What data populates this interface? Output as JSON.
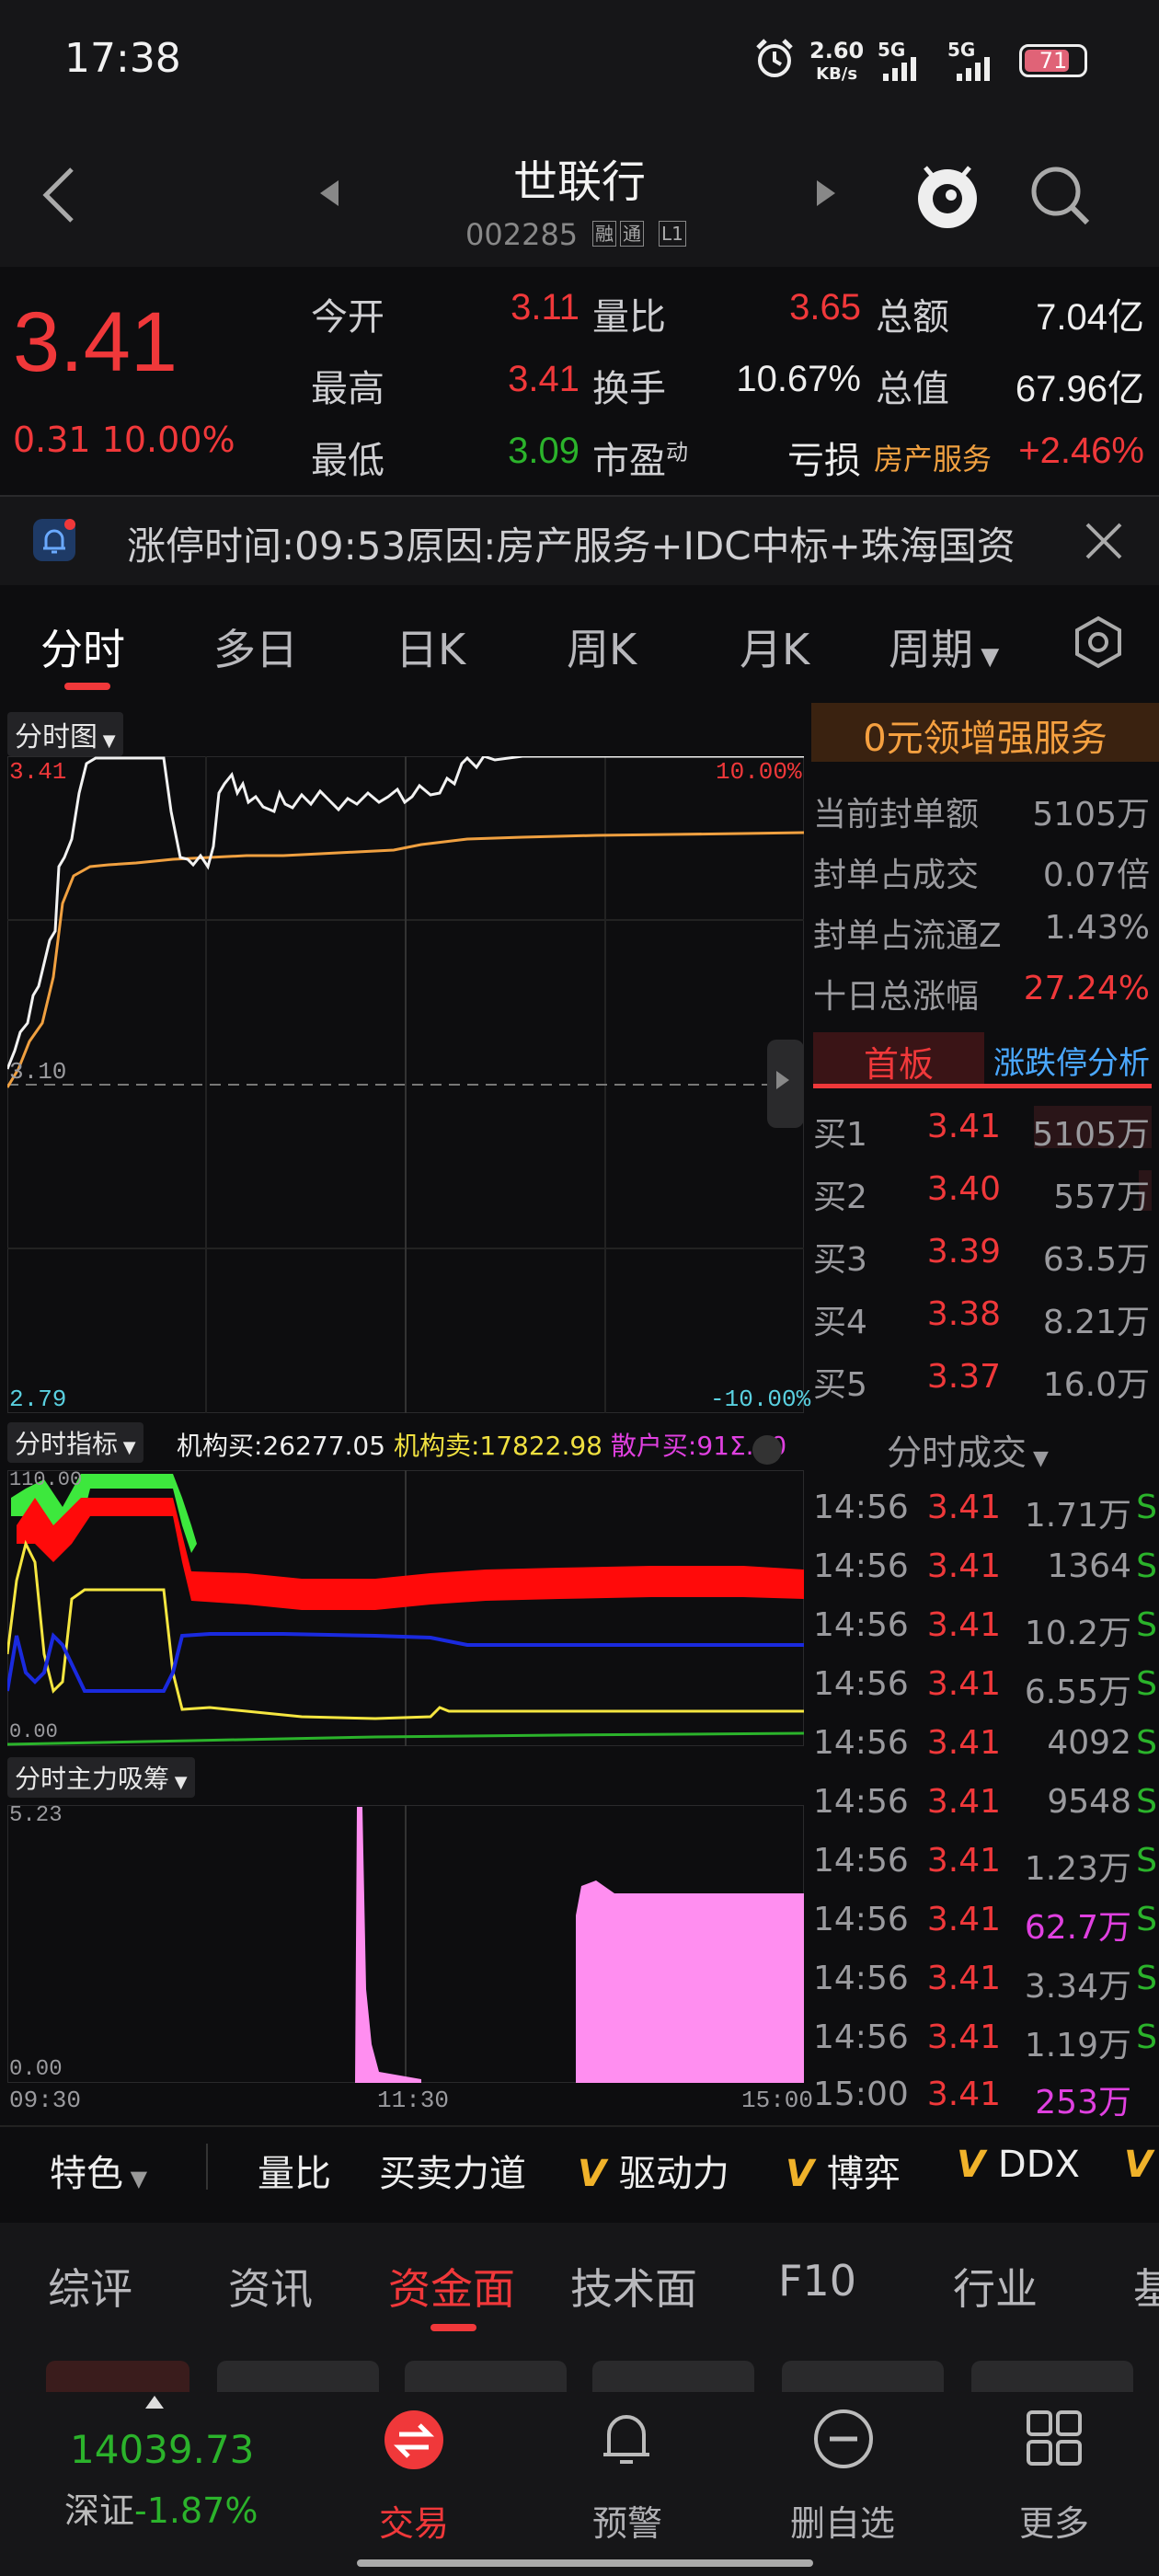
{
  "status_bar": {
    "time": "17:38",
    "net_speed_value": "2.60",
    "net_speed_unit": "KB/s",
    "sim1": "5G",
    "sim2": "5G",
    "battery": "71"
  },
  "header": {
    "name": "世联行",
    "code": "002285",
    "tags": [
      "融",
      "通",
      "L1"
    ]
  },
  "quote": {
    "price": "3.41",
    "change": "0.31",
    "change_pct": "10.00%",
    "rows": [
      {
        "l1": "今开",
        "v1": "3.11",
        "l2": "量比",
        "v2": "3.65",
        "l3": "总额",
        "v3": "7.04亿"
      },
      {
        "l1": "最高",
        "v1": "3.41",
        "l2": "换手",
        "v2": "10.67%",
        "l3": "总值",
        "v3": "67.96亿"
      },
      {
        "l1": "最低",
        "v1": "3.09",
        "l2": "市盈",
        "l2_sup": "动",
        "v2": "亏损",
        "l3": "房产服务",
        "v3": "+2.46%"
      }
    ]
  },
  "notice": {
    "text": "涨停时间:09:53原因:房产服务+IDC中标+珠海国资"
  },
  "period_tabs": [
    "分时",
    "多日",
    "日K",
    "周K",
    "月K",
    "周期"
  ],
  "minute_chart": {
    "dropdown": "分时图",
    "price_high": "3.41",
    "price_mid": "3.10",
    "price_low": "2.79",
    "pct_high": "10.00%",
    "pct_low": "-10.00%"
  },
  "indicator": {
    "dropdown": "分时指标",
    "inst_buy_label": "机构买:",
    "inst_buy": "26277.05",
    "inst_sell_label": "机构卖:",
    "inst_sell": "17822.98",
    "retail_buy_label": "散户买:",
    "retail_buy": "91Σ.40",
    "top": "110.00",
    "bottom": "0.00"
  },
  "absorb": {
    "dropdown": "分时主力吸筹",
    "top": "5.23",
    "bottom": "0.00",
    "t_start": "09:30",
    "t_mid": "11:30",
    "t_end": "15:00"
  },
  "right_panel": {
    "promo": "0元领增强服务",
    "stats": [
      {
        "label": "当前封单额",
        "value": "5105万"
      },
      {
        "label": "封单占成交",
        "value": "0.07倍"
      },
      {
        "label": "封单占流通Z",
        "value": "1.43%"
      },
      {
        "label": "十日总涨幅",
        "value": "27.24%"
      }
    ],
    "tab_first": "首板",
    "tab_second": "涨跌停分析",
    "bids": [
      {
        "label": "买1",
        "price": "3.41",
        "vol": "5105万"
      },
      {
        "label": "买2",
        "price": "3.40",
        "vol": "557万"
      },
      {
        "label": "买3",
        "price": "3.39",
        "vol": "63.5万"
      },
      {
        "label": "买4",
        "price": "3.38",
        "vol": "8.21万"
      },
      {
        "label": "买5",
        "price": "3.37",
        "vol": "16.0万"
      }
    ],
    "trades_title": "分时成交",
    "trades": [
      {
        "t": "14:56",
        "p": "3.41",
        "v": "1.71万",
        "s": "S"
      },
      {
        "t": "14:56",
        "p": "3.41",
        "v": "1364",
        "s": "S"
      },
      {
        "t": "14:56",
        "p": "3.41",
        "v": "10.2万",
        "s": "S"
      },
      {
        "t": "14:56",
        "p": "3.41",
        "v": "6.55万",
        "s": "S"
      },
      {
        "t": "14:56",
        "p": "3.41",
        "v": "4092",
        "s": "S"
      },
      {
        "t": "14:56",
        "p": "3.41",
        "v": "9548",
        "s": "S"
      },
      {
        "t": "14:56",
        "p": "3.41",
        "v": "1.23万",
        "s": "S"
      },
      {
        "t": "14:56",
        "p": "3.41",
        "v": "62.7万",
        "s": "S"
      },
      {
        "t": "14:56",
        "p": "3.41",
        "v": "3.34万",
        "s": "S"
      },
      {
        "t": "14:56",
        "p": "3.41",
        "v": "1.19万",
        "s": "S"
      },
      {
        "t": "15:00",
        "p": "3.41",
        "v": "253万",
        "s": ""
      }
    ]
  },
  "indicator_bar": {
    "first": "特色",
    "items": [
      "量比",
      "买卖力道",
      "驱动力",
      "博弈",
      "DDX",
      ""
    ]
  },
  "feature_tabs": [
    "综评",
    "资讯",
    "资金面",
    "技术面",
    "F10",
    "行业",
    "基"
  ],
  "bottom_nav": {
    "index_value": "14039.73",
    "index_name": "深证",
    "index_change": "-1.87%",
    "items": [
      "交易",
      "预警",
      "删自选",
      "更多"
    ]
  },
  "colors": {
    "up": "#f0383a",
    "down": "#2bb32b",
    "price_line": "#ffffff",
    "avg_line": "#f0a040",
    "absorb_fill": "#ff8ef0"
  }
}
